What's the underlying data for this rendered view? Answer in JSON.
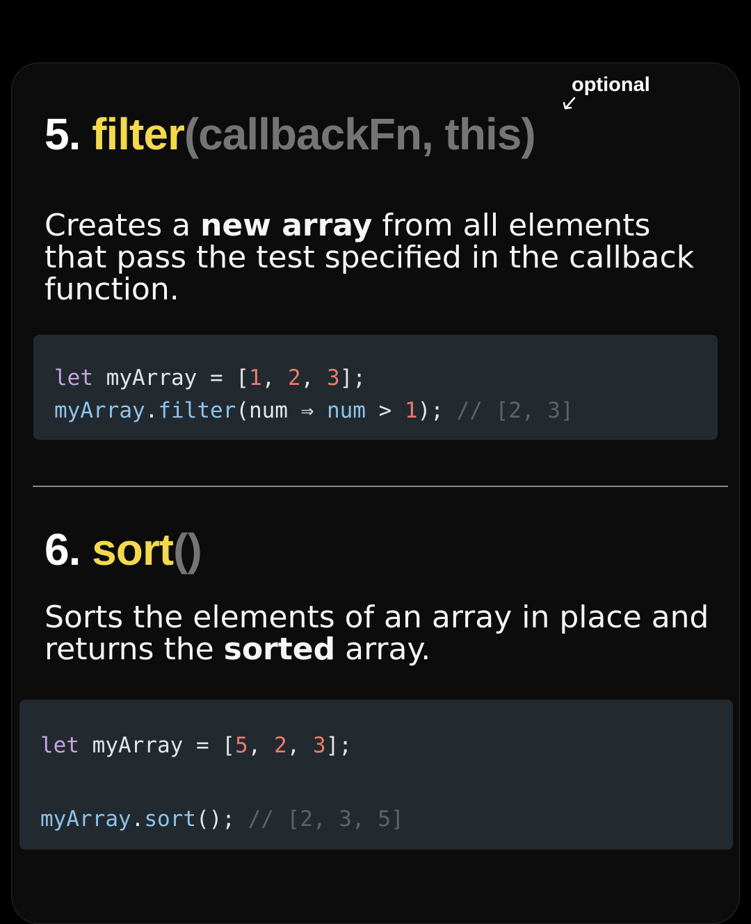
{
  "section5": {
    "annotation": "optional",
    "number": "5.",
    "method": "filter",
    "args": "(callbackFn, this)",
    "desc_pre": "Creates a ",
    "desc_bold": "new array",
    "desc_post": " from all elements that pass the test specified in the callback function.",
    "code": {
      "line1": {
        "kw": "let",
        "text": " myArray = [",
        "n1": "1",
        "s1": ", ",
        "n2": "2",
        "s2": ", ",
        "n3": "3",
        "end": "];"
      },
      "line2": {
        "obj": "myArray",
        "dot": ".",
        "method": "filter",
        "open": "(num ",
        "arrow": "⇒",
        "param": " num",
        "op": " > ",
        "n": "1",
        "close": ");",
        "comment": " // [2, 3]"
      }
    }
  },
  "section6": {
    "number": "6.",
    "method": "sort",
    "args": "()",
    "desc_pre": "Sorts the elements of an array in place and returns the ",
    "desc_bold": "sorted",
    "desc_post": " array.",
    "code": {
      "line1": {
        "kw": "let",
        "text": " myArray = [",
        "n1": "5",
        "s1": ", ",
        "n2": "2",
        "s2": ", ",
        "n3": "3",
        "end": "];"
      },
      "line2": {
        "obj": "myArray",
        "dot": ".",
        "method": "sort",
        "call": "();",
        "comment": " // [2, 3, 5]"
      }
    }
  },
  "colors": {
    "accent": "#f2d94e",
    "args_gray": "#757575",
    "code_bg": "#222a30",
    "keyword": "#c7a2e0",
    "function": "#8cc4ec",
    "number": "#ee7b6d",
    "comment": "#5b646c"
  }
}
